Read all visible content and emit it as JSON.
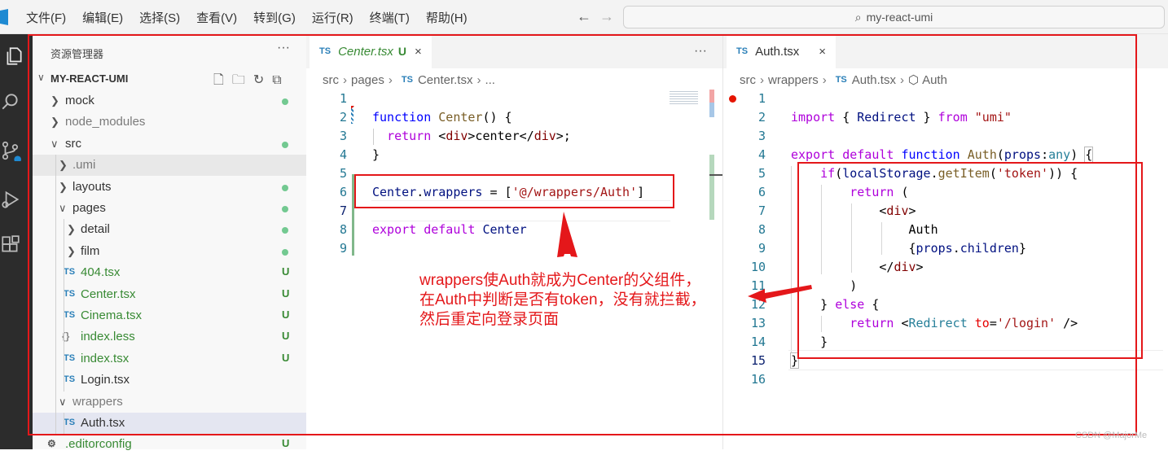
{
  "menu": [
    "文件(F)",
    "编辑(E)",
    "选择(S)",
    "查看(V)",
    "转到(G)",
    "运行(R)",
    "终端(T)",
    "帮助(H)"
  ],
  "nav": {
    "back": "←",
    "forward": "→"
  },
  "command_center": {
    "text": "my-react-umi"
  },
  "explorer": {
    "title": "资源管理器",
    "more": "···",
    "project": "MY-REACT-UMI",
    "items": [
      {
        "label": "mock",
        "status": "dot"
      },
      {
        "label": "node_modules",
        "status": ""
      },
      {
        "label": "src",
        "status": "dot"
      },
      {
        "label": ".umi",
        "status": ""
      },
      {
        "label": "layouts",
        "status": "dot"
      },
      {
        "label": "pages",
        "status": "dot"
      },
      {
        "label": "detail",
        "status": "dot"
      },
      {
        "label": "film",
        "status": "dot"
      },
      {
        "label": "404.tsx",
        "status": "U"
      },
      {
        "label": "Center.tsx",
        "status": "U"
      },
      {
        "label": "Cinema.tsx",
        "status": "U"
      },
      {
        "label": "index.less",
        "status": "U"
      },
      {
        "label": "index.tsx",
        "status": "U"
      },
      {
        "label": "Login.tsx",
        "status": ""
      },
      {
        "label": "wrappers",
        "status": ""
      },
      {
        "label": "Auth.tsx",
        "status": ""
      },
      {
        "label": ".editorconfig",
        "status": "U"
      }
    ]
  },
  "left_editor": {
    "tab": {
      "icon": "TS",
      "label": "Center.tsx",
      "status": "U",
      "close": "×"
    },
    "more": "···",
    "breadcrumb": [
      "src",
      "pages",
      "Center.tsx",
      "..."
    ],
    "lines": [
      "1",
      "2",
      "3",
      "4",
      "5",
      "6",
      "7",
      "8",
      "9"
    ]
  },
  "right_editor": {
    "tab": {
      "icon": "TS",
      "label": "Auth.tsx",
      "close": "×"
    },
    "breadcrumb": [
      "src",
      "wrappers",
      "Auth.tsx",
      "Auth"
    ],
    "lines": [
      "1",
      "2",
      "3",
      "4",
      "5",
      "6",
      "7",
      "8",
      "9",
      "10",
      "11",
      "12",
      "13",
      "14",
      "15",
      "16"
    ]
  },
  "annotation": [
    "wrappers使Auth就成为Center的父组件，",
    "在Auth中判断是否有token，没有就拦截，",
    "然后重定向登录页面"
  ],
  "watermark": "CSDN @MajorMe",
  "colors": {
    "annotation": "#e4171a",
    "keyword": "#0000ff",
    "activity_bar": "#2c2c2c",
    "untracked": "#388a34"
  }
}
